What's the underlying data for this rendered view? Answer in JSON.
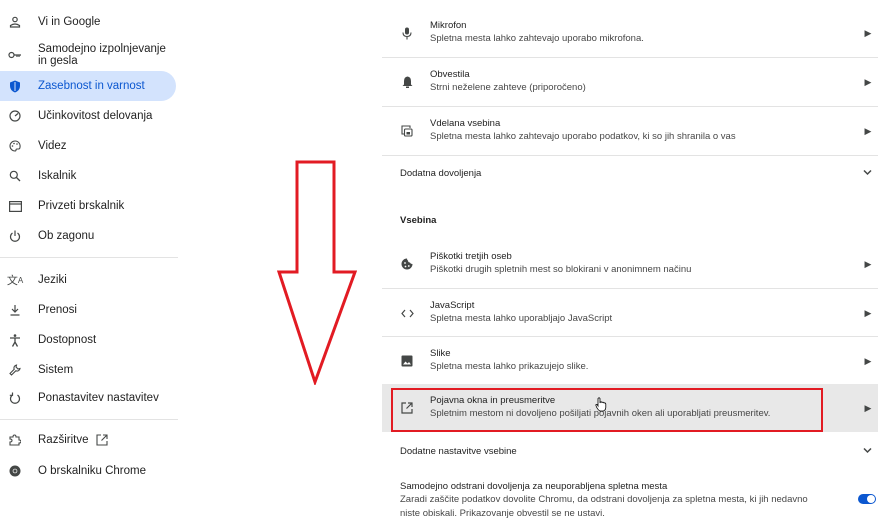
{
  "sidebar": {
    "items": [
      {
        "label": "Vi in Google",
        "icon": "person-icon"
      },
      {
        "label": "Samodejno izpolnjevanje in gesla",
        "icon": "key-icon"
      },
      {
        "label": "Zasebnost in varnost",
        "icon": "shield-icon",
        "active": true
      },
      {
        "label": "Učinkovitost delovanja",
        "icon": "speedometer-icon"
      },
      {
        "label": "Videz",
        "icon": "palette-icon"
      },
      {
        "label": "Iskalnik",
        "icon": "search-icon"
      },
      {
        "label": "Privzeti brskalnik",
        "icon": "browser-window-icon"
      },
      {
        "label": "Ob zagonu",
        "icon": "power-icon"
      },
      {
        "label": "Jeziki",
        "icon": "translate-icon"
      },
      {
        "label": "Prenosi",
        "icon": "download-icon"
      },
      {
        "label": "Dostopnost",
        "icon": "accessibility-icon"
      },
      {
        "label": "Sistem",
        "icon": "wrench-icon"
      },
      {
        "label": "Ponastavitev nastavitev",
        "icon": "reset-icon"
      },
      {
        "label": "Razširitve",
        "icon": "puzzle-icon"
      },
      {
        "label": "O brskalniku Chrome",
        "icon": "chrome-icon"
      }
    ],
    "accent_color": "#0b57d0",
    "active_bg": "#d3e3fd"
  },
  "panel": {
    "rows": [
      {
        "title": "Mikrofon",
        "desc": "Spletna mesta lahko zahtevajo uporabo mikrofona.",
        "icon": "microphone-icon"
      },
      {
        "title": "Obvestila",
        "desc": "Strni neželene zahteve (priporočeno)",
        "icon": "bell-icon"
      },
      {
        "title": "Vdelana vsebina",
        "desc": "Spletna mesta lahko zahtevajo uporabo podatkov, ki so jih shranila o vas",
        "icon": "embedded-content-icon"
      }
    ],
    "more_permissions": "Dodatna dovoljenja",
    "content_heading": "Vsebina",
    "content_rows": [
      {
        "title": "Piškotki tretjih oseb",
        "desc": "Piškotki drugih spletnih mest so blokirani v anonimnem načinu",
        "icon": "cookie-icon"
      },
      {
        "title": "JavaScript",
        "desc": "Spletna mesta lahko uporabljajo JavaScript",
        "icon": "code-icon"
      },
      {
        "title": "Slike",
        "desc": "Spletna mesta lahko prikazujejo slike.",
        "icon": "image-icon"
      },
      {
        "title": "Pojavna okna in preusmeritve",
        "desc": "Spletnim mestom ni dovoljeno pošiljati pojavnih oken ali uporabljati preusmeritev.",
        "icon": "open-in-new-icon"
      }
    ],
    "more_content": "Dodatne nastavitve vsebine",
    "auto_revoke": {
      "title": "Samodejno odstrani dovoljenja za neuporabljena spletna mesta",
      "desc": "Zaradi zaščite podatkov dovolite Chromu, da odstrani dovoljenja za spletna mesta, ki jih nedavno niste obiskali. Prikazovanje obvestil se ne ustavi.",
      "enabled": true
    },
    "annotation_color": "#e21b23"
  }
}
